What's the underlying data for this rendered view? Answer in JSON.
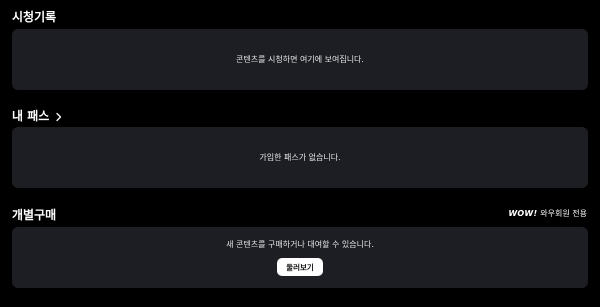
{
  "watch_history": {
    "title": "시청기록",
    "empty_text": "콘텐츠를 시청하면 여기에 보여집니다."
  },
  "my_pass": {
    "title": "내 패스",
    "chevron_icon": "chevron-right-icon",
    "empty_text": "가입한 패스가 없습니다."
  },
  "individual_purchase": {
    "title": "개별구매",
    "wow_logo": "WOW!",
    "wow_label": "와우회원 전용",
    "empty_text": "새 콘텐츠를 구매하거나 대여할 수 있습니다.",
    "browse_button_label": "둘러보기"
  },
  "colors": {
    "background": "#000000",
    "card": "#1c1e23",
    "button": "#ffffff"
  }
}
